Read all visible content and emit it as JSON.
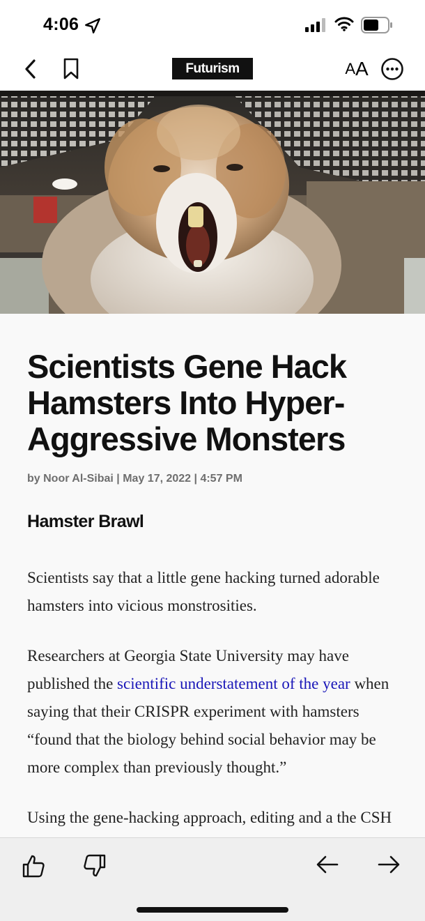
{
  "status_bar": {
    "time": "4:06",
    "icons": [
      "location-arrow-icon",
      "cellular-signal-icon",
      "wifi-icon",
      "battery-icon"
    ]
  },
  "nav": {
    "back_icon": "chevron-left-icon",
    "bookmark_icon": "bookmark-icon",
    "logo_text": "Futurism",
    "text_size_small": "A",
    "text_size_large": "A",
    "more_icon": "ellipsis-circle-icon"
  },
  "hero": {
    "icon": "hero-photo"
  },
  "article": {
    "headline": "Scientists Gene Hack Hamsters Into Hyper-Aggressive Monsters",
    "byline": "by Noor Al-Sibai | May 17, 2022 | 4:57 PM",
    "subhead": "Hamster Brawl",
    "p1": "Scientists say that a little gene hacking turned adorable hamsters into vicious monstrosities.",
    "p2_before": "Researchers at Georgia State University may have published the ",
    "p2_link": "scientific understatement of the year",
    "p2_after": " when saying that their CRISPR experiment with hamsters “found that the biology behind social be­havior may be more complex than previously thought.”",
    "p3_partial": "Using the gene-hacking approach, editing and a the CSH"
  },
  "toolbar": {
    "like_icon": "thumbs-up-icon",
    "dislike_icon": "thumbs-down-icon",
    "prev_icon": "arrow-left-icon",
    "next_icon": "arrow-right-icon"
  },
  "colors": {
    "link": "#1a17b8",
    "background": "#f9f9f9",
    "toolbar": "#efefef"
  }
}
